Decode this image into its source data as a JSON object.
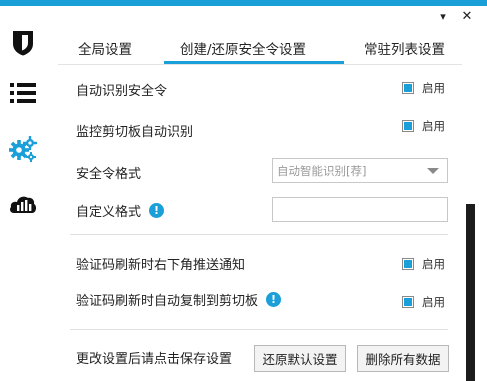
{
  "colors": {
    "accent": "#1a9fd9",
    "sidebar_icon": "#111111",
    "text": "#222222"
  },
  "sidebar": {
    "items": [
      {
        "icon": "shield-icon"
      },
      {
        "icon": "list-icon"
      },
      {
        "icon": "gears-icon"
      },
      {
        "icon": "cloud-chart-icon"
      }
    ]
  },
  "window": {
    "minimize_glyph": "▾",
    "close_glyph": "✕"
  },
  "tabs": [
    {
      "label": "全局设置"
    },
    {
      "label": "创建/还原安全令设置",
      "active": true
    },
    {
      "label": "常驻列表设置"
    }
  ],
  "settings": {
    "auto_detect": {
      "label": "自动识别安全令",
      "check_label": "启用",
      "checked": true
    },
    "clipboard_detect": {
      "label": "监控剪切板自动识别",
      "check_label": "启用",
      "checked": true
    },
    "format": {
      "label": "安全令格式",
      "selected": "自动智能识别[荐]"
    },
    "custom_format": {
      "label": "自定义格式",
      "value": "",
      "info_glyph": "!"
    },
    "refresh_notify": {
      "label": "验证码刷新时右下角推送通知",
      "check_label": "启用",
      "checked": true
    },
    "refresh_copy": {
      "label": "验证码刷新时自动复制到剪切板",
      "check_label": "启用",
      "checked": true,
      "info_glyph": "!"
    }
  },
  "footer": {
    "hint": "更改设置后请点击保存设置",
    "restore_button": "还原默认设置",
    "delete_button": "删除所有数据"
  }
}
